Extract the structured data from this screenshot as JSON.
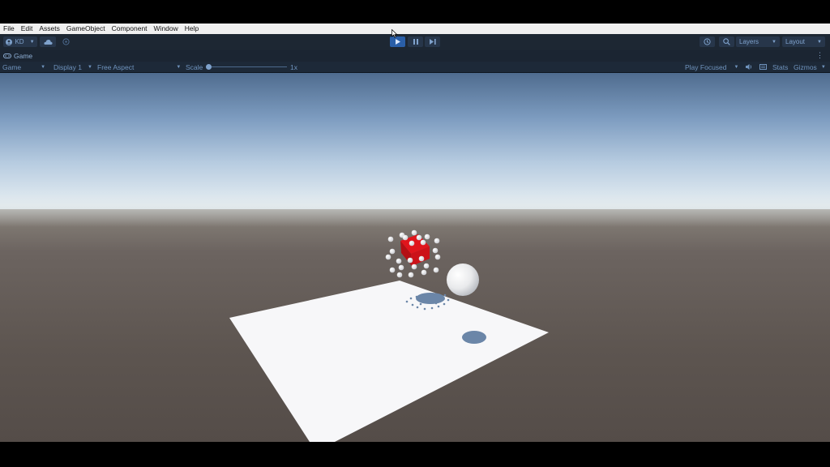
{
  "menubar": {
    "items": [
      "File",
      "Edit",
      "Assets",
      "GameObject",
      "Component",
      "Window",
      "Help"
    ]
  },
  "toolbar": {
    "account_label": "KD",
    "layers_label": "Layers",
    "layout_label": "Layout",
    "play_state": "playing"
  },
  "tabs": {
    "game_tab_label": "Game"
  },
  "game_view_bar": {
    "view_select": "Game",
    "display_select": "Display 1",
    "aspect_select": "Free Aspect",
    "scale_label": "Scale",
    "scale_value": "1x",
    "play_mode_select": "Play Focused",
    "stats_label": "Stats",
    "gizmos_label": "Gizmos"
  },
  "colors": {
    "accent_play": "#2a5fa8",
    "toolbar_bg": "#1d2733",
    "cube_red": "#e0151c",
    "plane_white": "#f7f7f9",
    "shadow_blue": "#6b86a8"
  },
  "icons": {
    "account": "account-icon",
    "cloud": "cloud-icon",
    "collab": "collab-icon",
    "play": "play-icon",
    "pause": "pause-icon",
    "step": "step-icon",
    "history": "history-icon",
    "search": "search-icon",
    "gamepad": "gamepad-icon",
    "mute": "speaker-icon",
    "stats": "stats-icon",
    "more": "kebab-menu-icon"
  }
}
